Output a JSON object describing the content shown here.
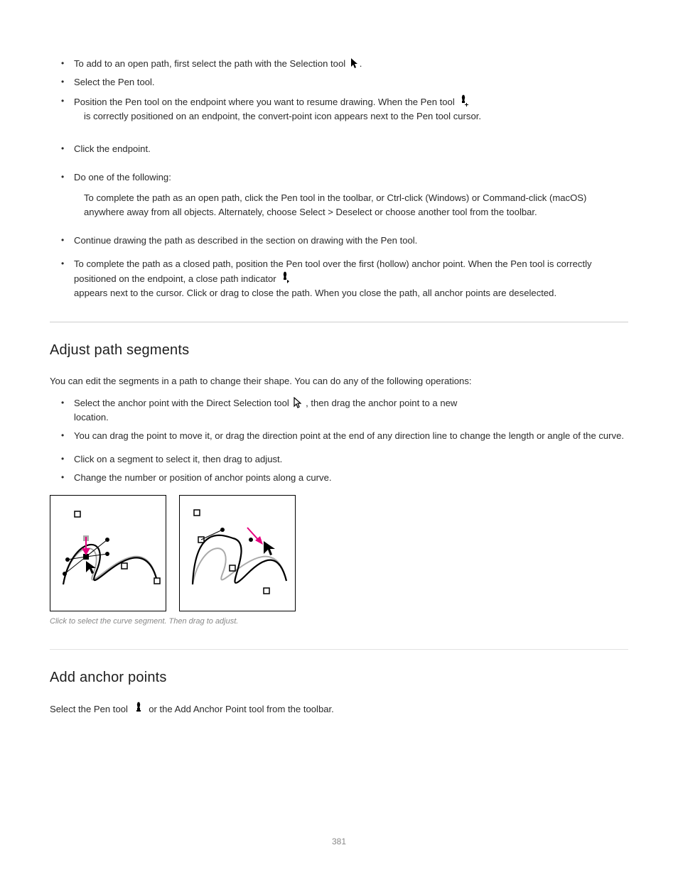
{
  "bullets_top": [
    "To add to an open path, first select the path with the Selection tool",
    "Select the Pen tool.",
    "Position the Pen tool on the endpoint where you want to resume drawing. When the Pen tool",
    "",
    "Click the endpoint.",
    "Do one of the following:"
  ],
  "bullets_top_extra": {
    "b3_cont": "is correctly positioned on an endpoint, the convert-point icon appears next to the Pen tool cursor.",
    "b5_sub_a": "To complete the path as an open path, click the Pen tool in the toolbar, or Ctrl-click (Windows) or Command-click (macOS) anywhere away from all objects. Alternately, choose Select > Deselect or choose another tool from the toolbar.",
    "b5_sub_b": "To complete the path as a closed path, position the Pen tool over the first (hollow) anchor point. When the Pen tool is correctly positioned on the endpoint, a close path indicator",
    "b5_sub_b_cont": "appears next to the cursor. Click or drag to close the path. When you close the path, all anchor points are deselected."
  },
  "top_continue_line": "Continue drawing the path as described in the section on drawing with the Pen tool.",
  "section1": {
    "title": "Adjust path segments",
    "intro": "You can edit the segments in a path to change their shape. You can do any of the following operations:",
    "bullets": [
      "Select the anchor point with the Direct Selection tool",
      "",
      "Click on a segment to select it, then drag to adjust.",
      "Change the number or position of anchor points along a curve."
    ],
    "bullet_1_extra": "You can drag the point to move it, or drag the direction point at the end of any direction line to change the length or angle of the curve.",
    "bullet_2_cont": ", then drag the anchor point to a new",
    "bullet_2_extra": "location."
  },
  "figure_caption": "Click to select the curve segment. Then drag to adjust.",
  "section2": {
    "title": "Add anchor points",
    "body": "Select the Pen tool",
    "body_cont": "or the Add Anchor Point tool from the toolbar."
  },
  "page_number": "381"
}
